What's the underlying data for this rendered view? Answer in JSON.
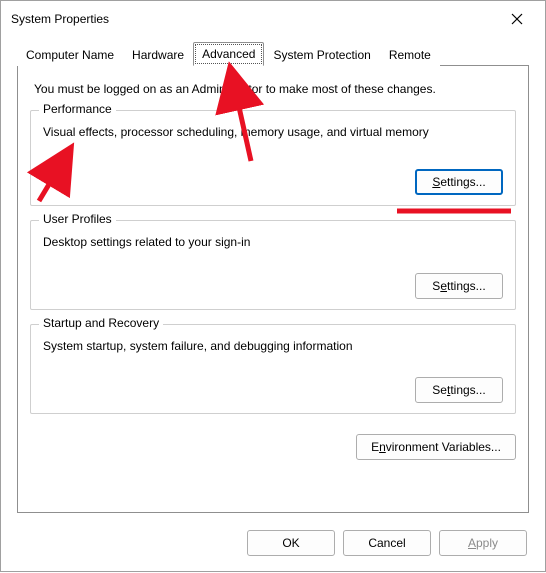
{
  "window": {
    "title": "System Properties"
  },
  "tabs": {
    "computer_name": "Computer Name",
    "hardware": "Hardware",
    "advanced": "Advanced",
    "system_protection": "System Protection",
    "remote": "Remote"
  },
  "advanced": {
    "admin_note": "You must be logged on as an Administrator to make most of these changes.",
    "performance": {
      "legend": "Performance",
      "desc": "Visual effects, processor scheduling, memory usage, and virtual memory",
      "settings_label": "Settings..."
    },
    "user_profiles": {
      "legend": "User Profiles",
      "desc": "Desktop settings related to your sign-in",
      "settings_label": "Settings..."
    },
    "startup_recovery": {
      "legend": "Startup and Recovery",
      "desc": "System startup, system failure, and debugging information",
      "settings_label": "Settings..."
    },
    "env_vars_label": "Environment Variables..."
  },
  "footer": {
    "ok": "OK",
    "cancel": "Cancel",
    "apply": "Apply"
  }
}
